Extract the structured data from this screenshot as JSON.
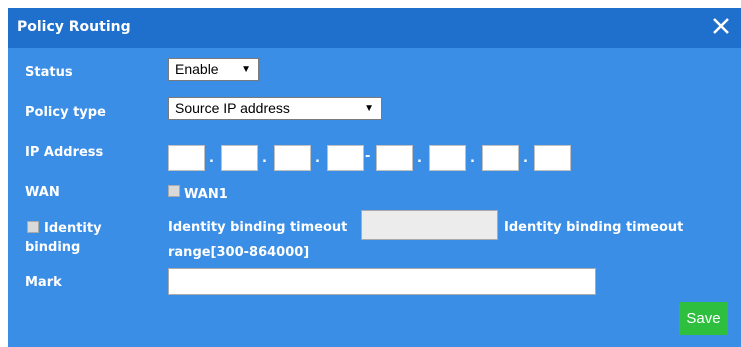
{
  "dialog": {
    "title": "Policy Routing",
    "close_icon": "close-icon"
  },
  "status": {
    "label": "Status",
    "value": "Enable"
  },
  "policy_type": {
    "label": "Policy type",
    "value": "Source IP address"
  },
  "ip_address": {
    "label": "IP Address",
    "separator_dot": ".",
    "separator_range": "-"
  },
  "wan": {
    "label": "WAN",
    "option": "WAN1"
  },
  "identity": {
    "label_line1": "Identity",
    "label_line2": "binding",
    "timeout_label": "Identity binding timeout",
    "range_label_line1": "Identity binding timeout",
    "range_label_line2": "range[300-864000]"
  },
  "mark": {
    "label": "Mark",
    "value": ""
  },
  "actions": {
    "save_label": "Save"
  },
  "colors": {
    "titlebar": "#1f6fcc",
    "body": "#3a8ee6",
    "save_button": "#2ebf3f"
  }
}
